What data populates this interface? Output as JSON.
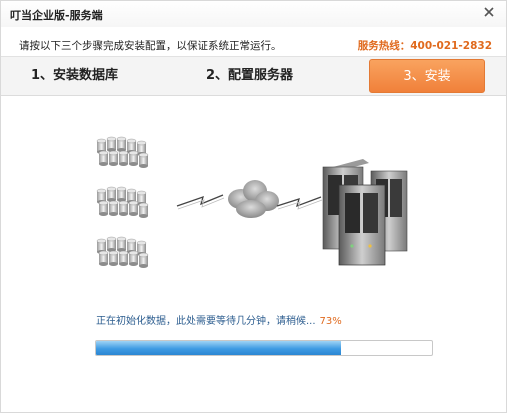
{
  "window": {
    "title": "叮当企业版-服务端"
  },
  "header": {
    "instruction": "请按以下三个步骤完成安装配置，以保证系统正常运行。",
    "hotline_label": "服务热线：",
    "hotline_number": "400-021-2832"
  },
  "steps": [
    {
      "label": "1、安装数据库",
      "active": false
    },
    {
      "label": "2、配置服务器",
      "active": false
    },
    {
      "label": "3、安装",
      "active": true
    }
  ],
  "progress": {
    "status_text": "正在初始化数据，此处需要等待几分钟，请稍候...",
    "percent_label": "73%",
    "value": 0.73
  },
  "colors": {
    "accent_orange": "#f0803a",
    "hotline": "#e06a1e",
    "status_text": "#2c5d8f",
    "progress_fill": "#3f9be3"
  },
  "icons": [
    "close-icon",
    "database-icon",
    "cloud-icon",
    "lightning-icon",
    "server-icon"
  ]
}
